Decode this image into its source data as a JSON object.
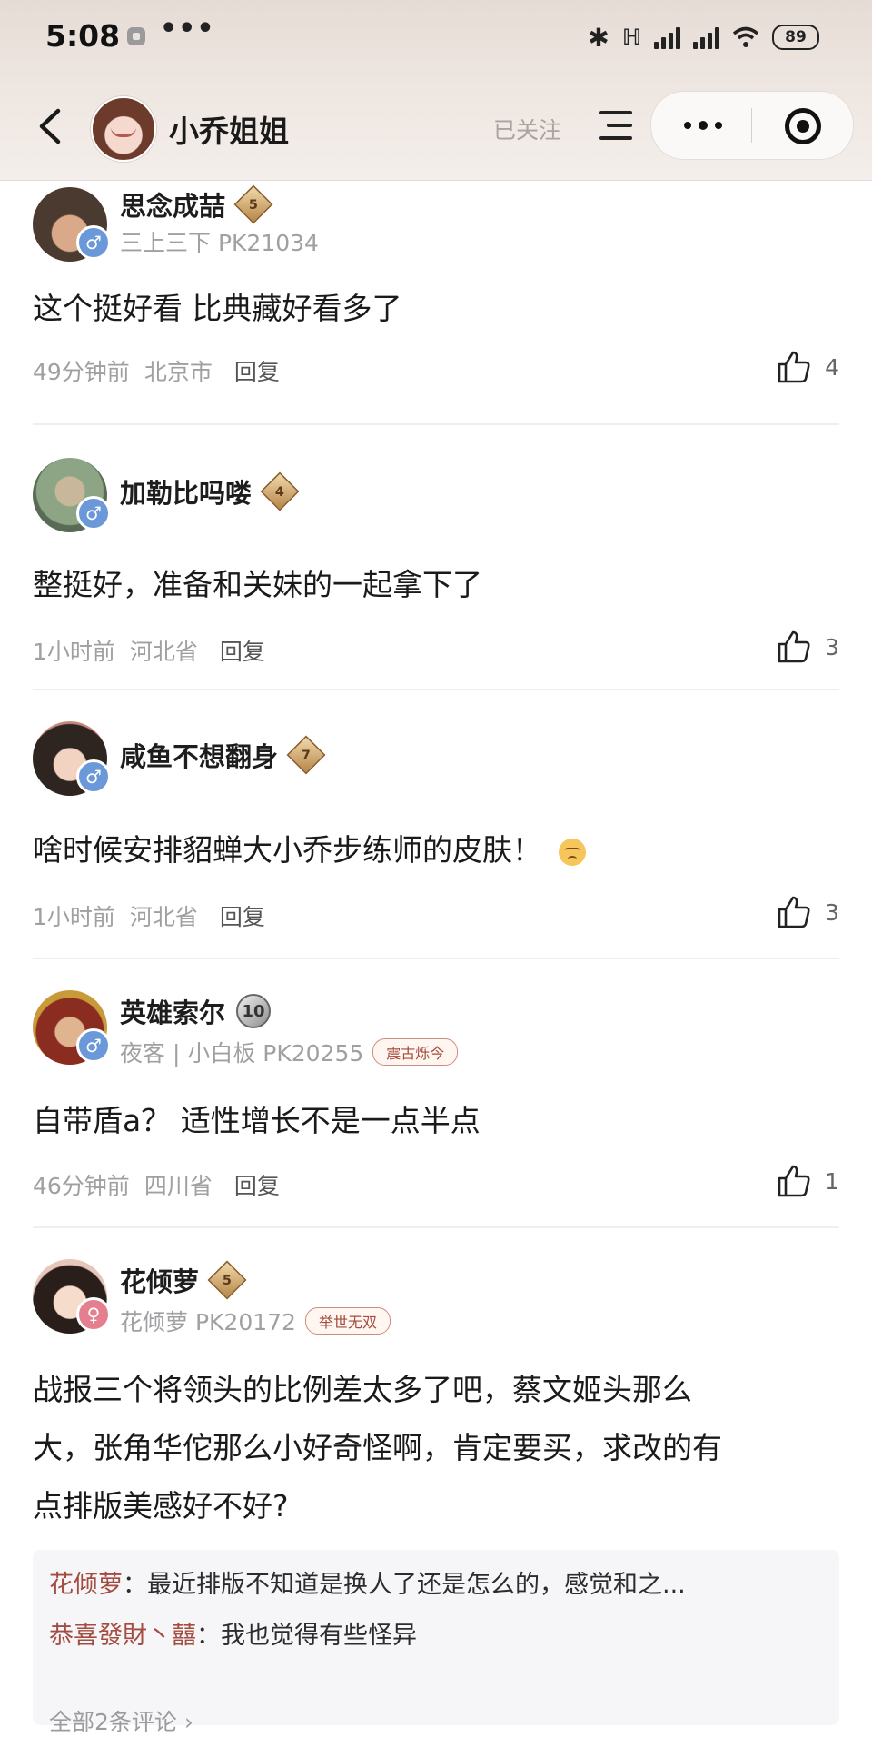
{
  "status_bar": {
    "time": "5:08",
    "dots": "•••",
    "battery": "89"
  },
  "header": {
    "title": "小乔姐姐",
    "follow_state": "已关注"
  },
  "comments": [
    {
      "username": "思念成喆",
      "level": "5",
      "sub": "三上三下 PK21034",
      "tag": "",
      "text": "这个挺好看 比典藏好看多了",
      "time": "49分钟前",
      "location": "北京市",
      "reply": "回复",
      "likes": "4",
      "gender": "male"
    },
    {
      "username": "加勒比吗喽",
      "level": "4",
      "sub": "",
      "tag": "",
      "text": "整挺好，准备和关妹的一起拿下了",
      "time": "1小时前",
      "location": "河北省",
      "reply": "回复",
      "likes": "3",
      "gender": "male"
    },
    {
      "username": "咸鱼不想翻身",
      "level": "7",
      "sub": "",
      "tag": "",
      "text": "啥时候安排貂蝉大小乔步练师的皮肤！",
      "time": "1小时前",
      "location": "河北省",
      "reply": "回复",
      "likes": "3",
      "gender": "male"
    },
    {
      "username": "英雄索尔",
      "level": "10",
      "sub": "夜客 | 小白板 PK20255",
      "tag": "震古烁今",
      "text": "自带盾a？ 适性增长不是一点半点",
      "time": "46分钟前",
      "location": "四川省",
      "reply": "回复",
      "likes": "1",
      "gender": "male"
    },
    {
      "username": "花倾萝",
      "level": "5",
      "sub": "花倾萝 PK20172",
      "tag": "举世无双",
      "text_lines": [
        "战报三个将领头的比例差太多了吧，蔡文姬头那么",
        "大，张角华佗那么小好奇怪啊，肯定要买，求改的有",
        "点排版美感好不好?"
      ],
      "gender": "female"
    }
  ],
  "replies": [
    {
      "name": "花倾萝",
      "text": "最近排版不知道是换人了还是怎么的，感觉和之..."
    },
    {
      "name": "恭喜發財丶囍",
      "text": "我也觉得有些怪异"
    }
  ],
  "more_replies": "全部2条评论 ›"
}
